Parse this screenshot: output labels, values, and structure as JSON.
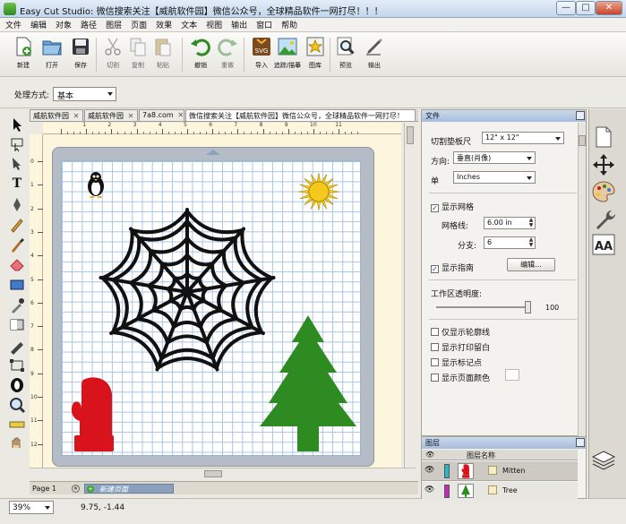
{
  "window": {
    "title": "Easy Cut Studio: 微信搜索关注【威航软件园】微信公众号，全球精品软件一网打尽！！！",
    "controls": [
      "—",
      "□",
      "✕"
    ]
  },
  "menu": [
    "文件",
    "编辑",
    "对象",
    "路径",
    "图层",
    "页面",
    "效果",
    "文本",
    "视图",
    "输出",
    "窗口",
    "帮助"
  ],
  "toolbar": [
    {
      "label": "新建",
      "icon": "new-document-icon"
    },
    {
      "label": "打开",
      "icon": "open-folder-icon"
    },
    {
      "label": "保存",
      "icon": "save-disk-icon"
    },
    {
      "label": "切割",
      "icon": "cut-scissors-icon"
    },
    {
      "label": "复制",
      "icon": "copy-icon"
    },
    {
      "label": "粘贴",
      "icon": "paste-icon"
    },
    {
      "label": "撤销",
      "icon": "undo-icon"
    },
    {
      "label": "重做",
      "icon": "redo-icon"
    },
    {
      "label": "导入",
      "icon": "import-svg-icon"
    },
    {
      "label": "追踪/描摹",
      "icon": "trace-image-icon"
    },
    {
      "label": "图库",
      "icon": "library-star-icon"
    },
    {
      "label": "预览",
      "icon": "preview-magnifier-icon"
    },
    {
      "label": "输出",
      "icon": "output-pen-icon"
    }
  ],
  "process": {
    "label": "处理方式:",
    "value": "基本"
  },
  "tabs": [
    {
      "label": "威航软件园"
    },
    {
      "label": "威航软件园"
    },
    {
      "label": "7a8.com"
    },
    {
      "label": "微信搜索关注【威航软件园】微信公众号，全球精品软件一网打尽！"
    }
  ],
  "canvas": {
    "hruler_ticks": [
      "1",
      "2",
      "3",
      "4",
      "5",
      "6",
      "7",
      "8",
      "9",
      "10",
      "11"
    ],
    "vruler_ticks": [
      "0",
      "1",
      "2",
      "3",
      "4",
      "5",
      "6",
      "7",
      "8",
      "9",
      "10",
      "11",
      "12"
    ],
    "shapes": [
      {
        "name": "penguin"
      },
      {
        "name": "sun"
      },
      {
        "name": "spider-web"
      },
      {
        "name": "tree"
      },
      {
        "name": "mitten"
      }
    ]
  },
  "pagebar": {
    "page": "Page 1",
    "new_page": "新建页面"
  },
  "status": {
    "zoom": "39%",
    "coords": "9.75, -1.44"
  },
  "panel": {
    "title": "文件",
    "mat_label": "切割垫板尺",
    "mat_value": "12\" x 12\"",
    "orient_label": "方向:",
    "orient_value": "垂直(肖像)",
    "unit_label": "单",
    "unit_value": "Inches",
    "show_grid": "显示网格",
    "grid_label": "网格线:",
    "grid_value": "6.00 in",
    "div_label": "分支:",
    "div_value": "6",
    "show_guides": "显示指南",
    "edit_button": "编辑...",
    "opacity_label": "工作区透明度:",
    "opacity_value": "100",
    "outline_only": "仅显示轮廓线",
    "show_print_margin": "显示打印留白",
    "show_markers": "显示标记点",
    "show_page_color": "显示页面颜色"
  },
  "layers": {
    "title": "图层",
    "col_name": "图层名称",
    "items": [
      {
        "name": "Mitten",
        "color": "#2ab8c8"
      },
      {
        "name": "Tree",
        "color": "#c82ab8"
      }
    ]
  },
  "colors": {
    "tree": "#2e8b22",
    "mitten": "#d8131b",
    "sun": "#f4c81c",
    "grid": "#a8c4e4"
  }
}
